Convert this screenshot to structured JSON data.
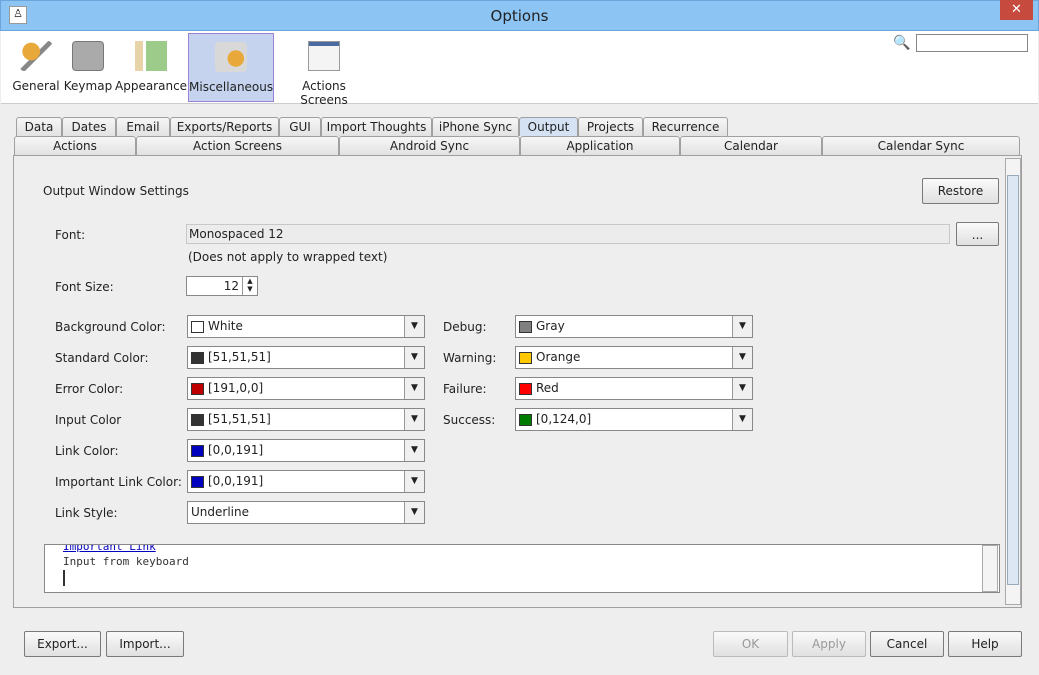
{
  "window": {
    "title": "Options",
    "close": "✕"
  },
  "toolbar": {
    "items": [
      {
        "label": "General"
      },
      {
        "label": "Keymap"
      },
      {
        "label": "Appearance"
      },
      {
        "label": "Miscellaneous"
      },
      {
        "label": "Actions Screens"
      }
    ],
    "search_icon": "🔍",
    "search_value": ""
  },
  "tabs": {
    "row1": [
      "Data",
      "Dates",
      "Email",
      "Exports/Reports",
      "GUI",
      "Import Thoughts",
      "iPhone Sync",
      "Output",
      "Projects",
      "Recurrence"
    ],
    "row2": [
      "Actions",
      "Action Screens",
      "Android Sync",
      "Application",
      "Calendar",
      "Calendar Sync"
    ],
    "selected": "Output"
  },
  "panel": {
    "section_title": "Output Window Settings",
    "restore": "Restore",
    "font_label": "Font:",
    "font_value": "Monospaced 12",
    "font_button": "...",
    "font_note": "(Does not apply to wrapped text)",
    "font_size_label": "Font Size:",
    "font_size_value": "12",
    "left_colors": [
      {
        "label": "Background Color:",
        "value": "White",
        "color": "#ffffff"
      },
      {
        "label": "Standard Color:",
        "value": "[51,51,51]",
        "color": "#333333"
      },
      {
        "label": "Error Color:",
        "value": "[191,0,0]",
        "color": "#bf0000"
      },
      {
        "label": "Input Color",
        "value": "[51,51,51]",
        "color": "#333333"
      },
      {
        "label": "Link Color:",
        "value": "[0,0,191]",
        "color": "#0000bf"
      },
      {
        "label": "Important Link Color:",
        "value": "[0,0,191]",
        "color": "#0000bf"
      }
    ],
    "link_style_label": "Link Style:",
    "link_style_value": "Underline",
    "right_colors": [
      {
        "label": "Debug:",
        "value": "Gray",
        "color": "#808080"
      },
      {
        "label": "Warning:",
        "value": "Orange",
        "color": "#ffc800"
      },
      {
        "label": "Failure:",
        "value": "Red",
        "color": "#ff0000"
      },
      {
        "label": "Success:",
        "value": "[0,124,0]",
        "color": "#007c00"
      }
    ],
    "preview_lines": [
      "Important Link",
      "Input from keyboard"
    ]
  },
  "footer": {
    "export": "Export...",
    "import": "Import...",
    "ok": "OK",
    "apply": "Apply",
    "cancel": "Cancel",
    "help": "Help"
  }
}
